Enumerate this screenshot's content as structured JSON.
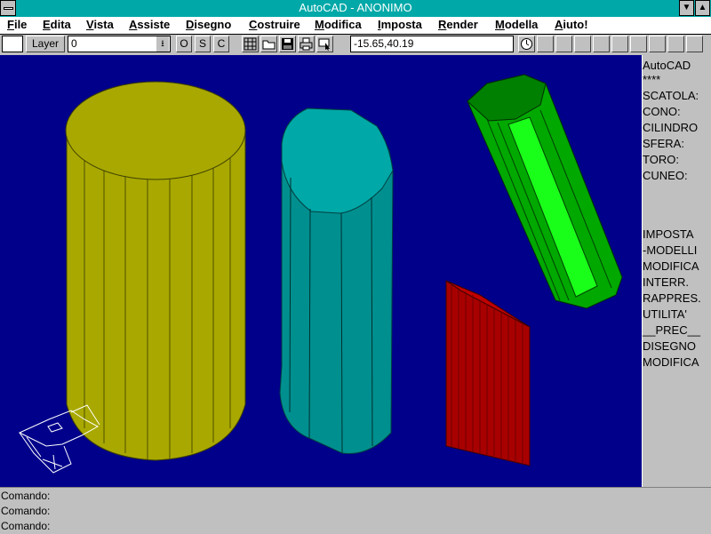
{
  "window": {
    "title": "AutoCAD - ANONIMO"
  },
  "menu": [
    {
      "label": "File",
      "key": "F",
      "rest": "ile"
    },
    {
      "label": "Edita",
      "key": "E",
      "rest": "dita"
    },
    {
      "label": "Vista",
      "key": "V",
      "rest": "ista"
    },
    {
      "label": "Assiste",
      "key": "A",
      "rest": "ssiste"
    },
    {
      "label": "Disegno",
      "key": "D",
      "rest": "isegno"
    },
    {
      "label": "Costruire",
      "key": "C",
      "rest": "ostruire"
    },
    {
      "label": "Modifica",
      "key": "M",
      "rest": "odifica"
    },
    {
      "label": "Imposta",
      "key": "I",
      "rest": "mposta"
    },
    {
      "label": "Render",
      "key": "R",
      "rest": "ender"
    },
    {
      "label": "Modella",
      "key": "M",
      "rest": "odella"
    },
    {
      "label": "Aiuto!",
      "key": "A",
      "rest": "iuto!"
    }
  ],
  "toolbar": {
    "layer_button": "Layer",
    "layer_value": "0",
    "ortho": "O",
    "snap": "S",
    "c": "C",
    "coords": "-15.65,40.19"
  },
  "side_menu": {
    "header": "AutoCAD",
    "stars": "****",
    "items_top": [
      "SCATOLA:",
      "CONO:",
      "CILINDRO",
      "SFERA:",
      "TORO:",
      "CUNEO:"
    ],
    "items_bottom": [
      "IMPOSTA",
      "-MODELLI",
      "MODIFICA",
      "INTERR.",
      "RAPPRES.",
      "UTILITA'",
      "__PREC__",
      "DISEGNO",
      "MODIFICA"
    ]
  },
  "command": {
    "lines": [
      "Comando:",
      "Comando:",
      "Comando:"
    ]
  },
  "colors": {
    "titlebar": "#00a8a8",
    "viewport": "#00008b",
    "yellow_cylinder": "#a8a800",
    "cyan_cylinder": "#00a8a8",
    "green_cylinder": "#00a800",
    "red_box": "#a80000"
  }
}
